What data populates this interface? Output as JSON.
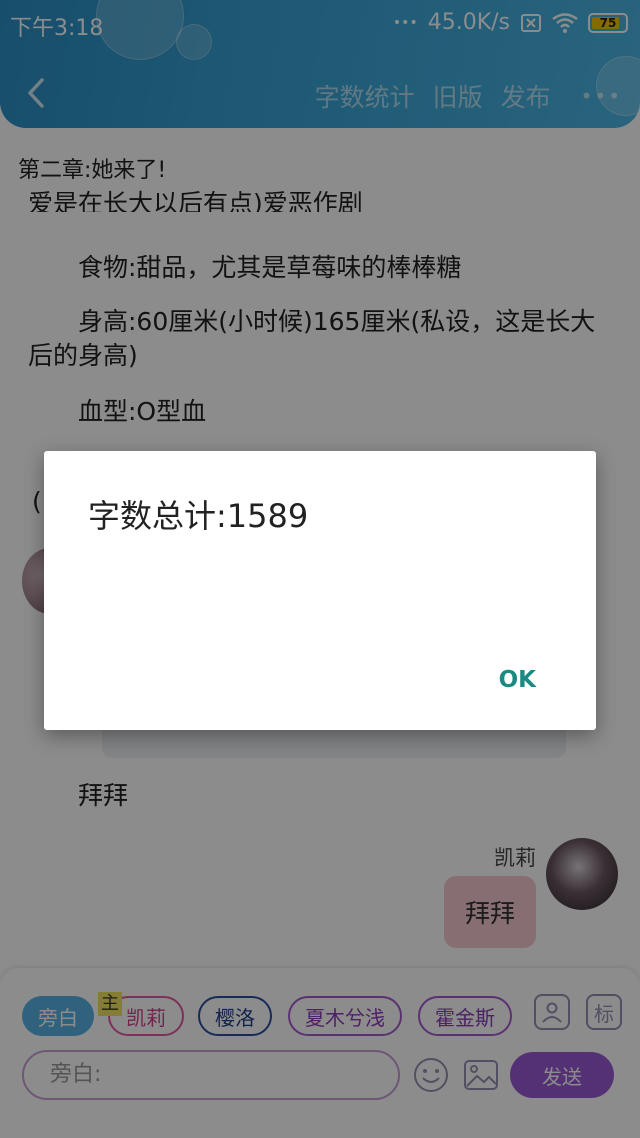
{
  "status_bar": {
    "time": "下午3:18",
    "network_speed": "45.0K/s",
    "battery_level": "75"
  },
  "navbar": {
    "word_count": "字数统计",
    "old_version": "旧版",
    "publish": "发布",
    "more": "•••"
  },
  "chapter_title": "第二章:她来了!",
  "paragraphs": {
    "partial_line": "爱是在长大以后有点)爱恶作剧",
    "food": "食物:甜品，尤其是草莓味的棒棒糖",
    "height": "身高:60厘米(小时候)165厘米(私设，这是长大后的身高)",
    "blood": "血型:O型血",
    "open_paren": "(",
    "bye": "拜拜"
  },
  "chat": {
    "speaker_name": "凯莉",
    "bubble_text": "拜拜"
  },
  "characters": {
    "narration": "旁白",
    "host_tag": "主",
    "kaili": "凯莉",
    "yingluo": "樱洛",
    "xiamu": "夏木兮浅",
    "huojinsi": "霍金斯",
    "tag_icon_text": "标"
  },
  "input": {
    "placeholder": "旁白:",
    "send_label": "发送"
  },
  "dialog": {
    "message": "字数总计:1589",
    "ok_label": "OK"
  },
  "colors": {
    "header_blue": "#37a4d6",
    "narration_chip": "#58b3e6",
    "send_button": "#9a59d4",
    "ok_teal": "#1b8a82",
    "battery_yellow": "#f2c200"
  }
}
